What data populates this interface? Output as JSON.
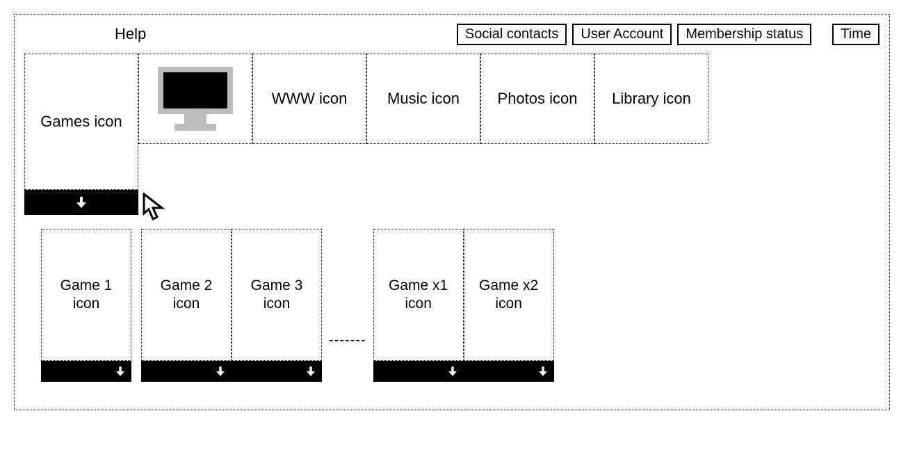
{
  "topbar": {
    "help_label": "Help",
    "social_label": "Social contacts",
    "account_label": "User Account",
    "membership_label": "Membership status",
    "time_label": "Time"
  },
  "categories": {
    "games_label": "Games icon",
    "tv_label": "",
    "www_label": "WWW icon",
    "music_label": "Music icon",
    "photos_label": "Photos icon",
    "library_label": "Library icon"
  },
  "games": {
    "item1_label": "Game 1 icon",
    "item2_label": "Game 2 icon",
    "item3_label": "Game 3 icon",
    "ellipsis": "-------",
    "itemx1_label": "Game x1 icon",
    "itemx2_label": "Game x2 icon"
  },
  "icons": {
    "arrow_down": "arrow-down-icon",
    "monitor": "monitor-icon",
    "cursor": "cursor-icon"
  }
}
